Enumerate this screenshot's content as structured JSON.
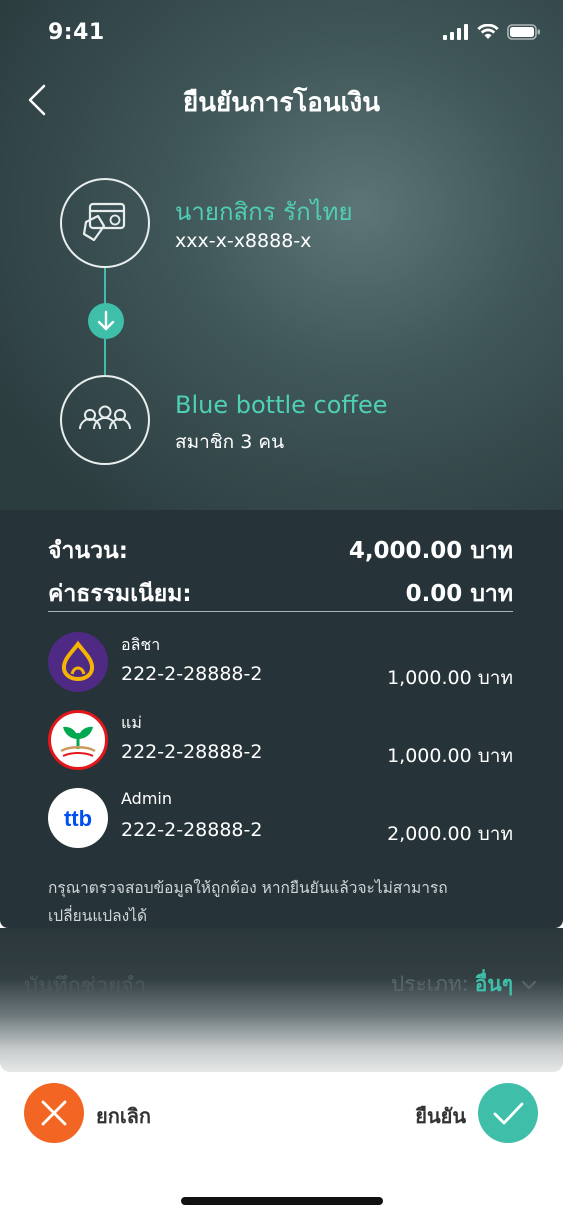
{
  "status_bar": {
    "time": "9:41"
  },
  "header": {
    "title": "ยืนยันการโอนเงิน"
  },
  "sender": {
    "name": "นายกสิกร รักไทย",
    "account": "xxx-x-x8888-x"
  },
  "recipient": {
    "name": "Blue bottle coffee",
    "members": "สมาชิก 3 คน"
  },
  "summary": {
    "amount_label": "จำนวน:",
    "amount_value": "4,000.00 บาท",
    "fee_label": "ค่าธรรมเนียม:",
    "fee_value": "0.00 บาท"
  },
  "members": [
    {
      "name": "อลิชา",
      "account": "222-2-28888-2",
      "amount": "1,000.00 บาท",
      "bank_icon": "scb-bank-icon"
    },
    {
      "name": "แม่",
      "account": "222-2-28888-2",
      "amount": "1,000.00 บาท",
      "bank_icon": "kbank-icon"
    },
    {
      "name": "Admin",
      "account": "222-2-28888-2",
      "amount": "2,000.00 บาท",
      "bank_icon": "ttb-icon",
      "bank_logo_text": "ttb"
    }
  ],
  "notice": "กรุณาตรวจสอบข้อมูลให้ถูกต้อง หากยืนยันแล้วจะไม่สามารถเปลี่ยนแปลงได้",
  "memo": {
    "placeholder": "บันทึกช่วยจำ",
    "type_label": "ประเภท:",
    "type_value": "อื่นๆ"
  },
  "actions": {
    "cancel_label": "ยกเลิก",
    "confirm_label": "ยืนยัน"
  },
  "colors": {
    "accent": "#3fbfa9",
    "cancel": "#f26522",
    "panel": "#263338",
    "scb": "#4e2a84",
    "kbank": "#00a950",
    "ttb_blue": "#0050f0"
  }
}
